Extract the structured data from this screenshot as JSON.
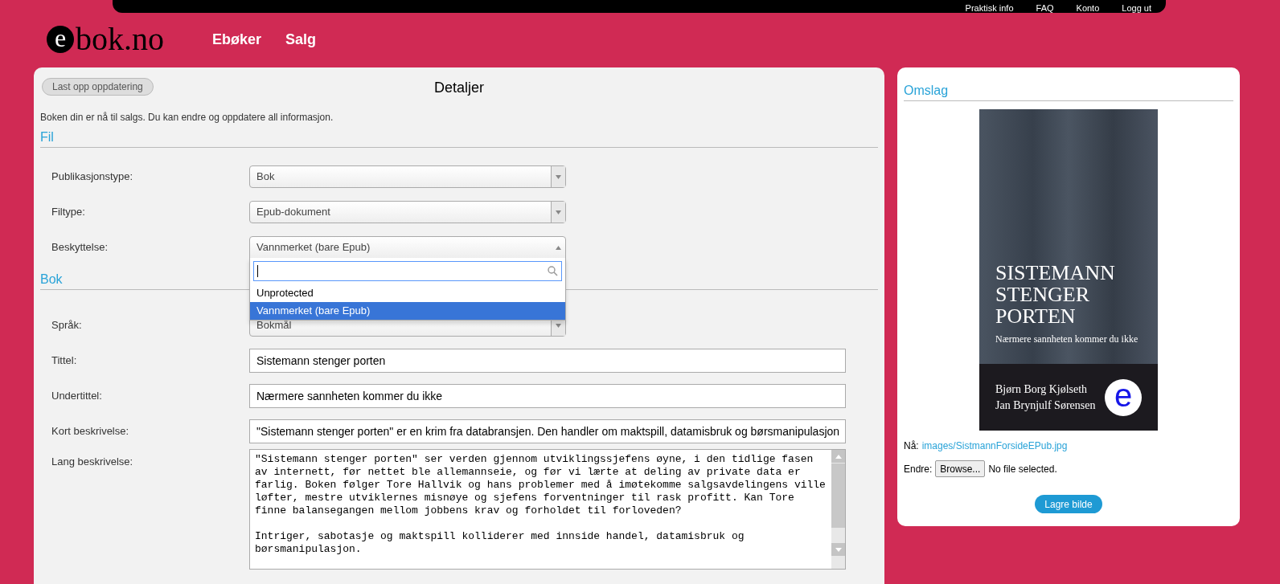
{
  "top_nav": [
    {
      "label": "Praktisk info"
    },
    {
      "label": "FAQ"
    },
    {
      "label": "Konto"
    },
    {
      "label": "Logg ut"
    }
  ],
  "logo": {
    "mark": "e",
    "text": "bok.no"
  },
  "main_nav": [
    {
      "label": "Ebøker"
    },
    {
      "label": "Salg"
    }
  ],
  "details": {
    "upload_button": "Last opp oppdatering",
    "title": "Detaljer",
    "notice": "Boken din er nå til salgs. Du kan endre og oppdatere all informasjon.",
    "sections": [
      {
        "heading": "Fil",
        "fields": [
          {
            "kind": "select",
            "label": "Publikasjonstype:",
            "value": "Bok",
            "open": false
          },
          {
            "kind": "select",
            "label": "Filtype:",
            "value": "Epub-dokument",
            "open": false
          },
          {
            "kind": "select",
            "label": "Beskyttelse:",
            "value": "Vannmerket (bare Epub)",
            "open": true,
            "options": [
              {
                "label": "Unprotected",
                "selected": false
              },
              {
                "label": "Vannmerket (bare Epub)",
                "selected": true
              }
            ]
          }
        ]
      },
      {
        "heading": "Bok",
        "fields": [
          {
            "kind": "select",
            "label": "Språk:",
            "value": "Bokmål",
            "open": false
          },
          {
            "kind": "text",
            "label": "Tittel:",
            "value": "Sistemann stenger porten"
          },
          {
            "kind": "text",
            "label": "Undertittel:",
            "value": "Nærmere sannheten kommer du ikke"
          },
          {
            "kind": "text",
            "label": "Kort beskrivelse:",
            "value": "\"Sistemann stenger porten\" er en krim fra databransjen. Den handler om maktspill, datamisbruk og børsmanipulasjon"
          },
          {
            "kind": "textarea",
            "label": "Lang beskrivelse:",
            "value": "\"Sistemann stenger porten\" ser verden gjennom utviklingssjefens øyne, i den tidlige fasen av internett, før nettet ble allemannseie, og før vi lærte at deling av private data er farlig. Boken følger Tore Hallvik og hans problemer med å imøtekomme salgsavdelingens ville løfter, mestre utviklernes misnøye og sjefens forventninger til rask profitt. Kan Tore finne balansegangen mellom jobbens krav og forholdet til forloveden?\n\nIntriger, sabotasje og maktspill kolliderer med innside handel, datamisbruk og børsmanipulasjon."
          }
        ]
      }
    ]
  },
  "cover_panel": {
    "heading": "Omslag",
    "cover": {
      "title": "SISTEMANN STENGER PORTEN",
      "subtitle": "Nærmere sannheten kommer du ikke",
      "authors": [
        "Bjørn Borg Kjølseth",
        "Jan Brynjulf Sørensen"
      ],
      "badge": "e"
    },
    "current_label": "Nå:",
    "current_file": "images/SistmannForsideEPub.jpg",
    "change_label": "Endre:",
    "browse_button": "Browse...",
    "file_status": "No file selected.",
    "save_button": "Lagre bilde"
  }
}
